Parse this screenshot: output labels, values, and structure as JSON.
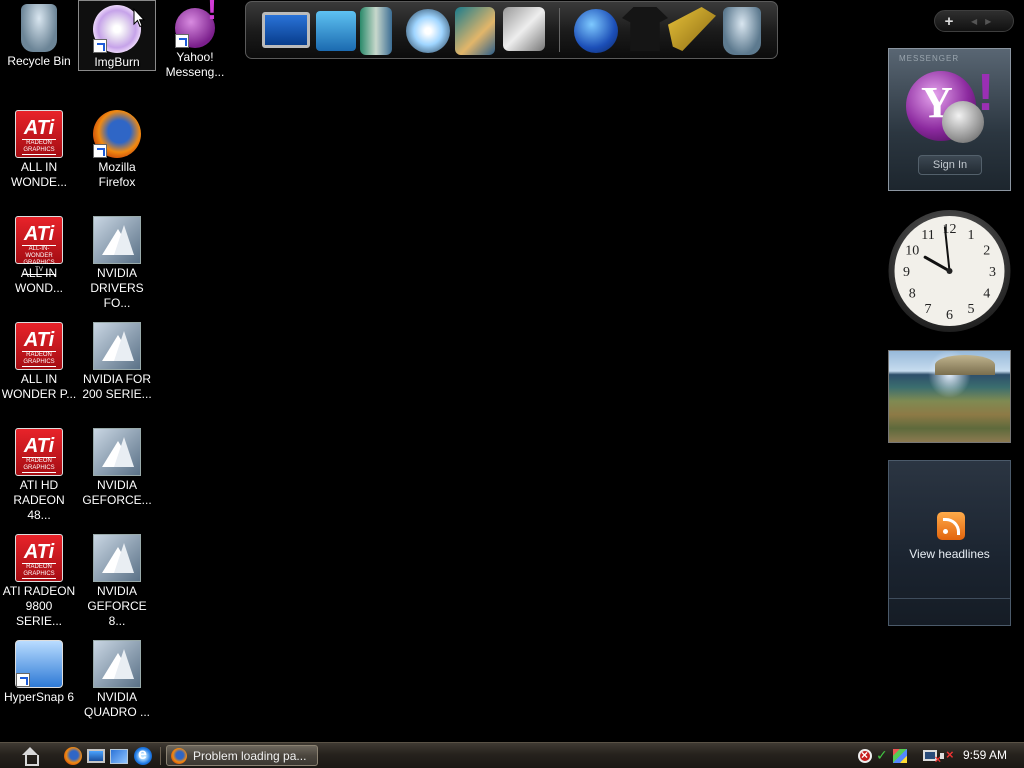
{
  "desktop": {
    "icons": [
      {
        "label": "Recycle Bin"
      },
      {
        "label": "ImgBurn"
      },
      {
        "label": "Yahoo! Messeng..."
      },
      {
        "label": "ALL IN WONDE..."
      },
      {
        "label": "Mozilla Firefox"
      },
      {
        "label": "ALL IN WOND..."
      },
      {
        "label": "NVIDIA DRIVERS FO..."
      },
      {
        "label": "ALL IN WONDER P..."
      },
      {
        "label": "NVIDIA FOR 200 SERIE..."
      },
      {
        "label": "ATI HD RADEON 48..."
      },
      {
        "label": "NVIDIA GEFORCE..."
      },
      {
        "label": "ATI RADEON 9800 SERIE..."
      },
      {
        "label": "NVIDIA GEFORCE 8..."
      },
      {
        "label": "HyperSnap 6"
      },
      {
        "label": "NVIDIA QUADRO ..."
      }
    ],
    "ati_logo": {
      "brand": "ATi",
      "sub_radeon": "RADEON GRAPHICS",
      "sub_aiw": "ALL-IN-WONDER GRAPHICS TV"
    }
  },
  "dock": {
    "items": [
      "monitor-icon",
      "network-icon",
      "documents-icon",
      "media-disc-icon",
      "pictures-icon",
      "tools-icon",
      "globe-icon",
      "tshirt-icon",
      "hammer-icon",
      "recycle-bin-icon"
    ]
  },
  "sidebar": {
    "controls": {
      "add": "+",
      "prev": "◀",
      "next": "▶"
    },
    "yahoo_gadget": {
      "header": "MESSENGER",
      "sign_in_label": "Sign In"
    },
    "clock": {
      "numbers": [
        "12",
        "1",
        "2",
        "3",
        "4",
        "5",
        "6",
        "7",
        "8",
        "9",
        "10",
        "11"
      ],
      "time": "9:59"
    },
    "feeds": {
      "view_headlines_label": "View headlines"
    }
  },
  "taskbar": {
    "active_task_label": "Problem loading pa...",
    "clock": "9:59 AM"
  },
  "colors": {
    "desktop_bg": "#000000",
    "taskbar": "#26221d",
    "ati_red": "#e8232a",
    "yahoo_purple": "#8c2a9f",
    "rss_orange": "#f07b1a"
  }
}
